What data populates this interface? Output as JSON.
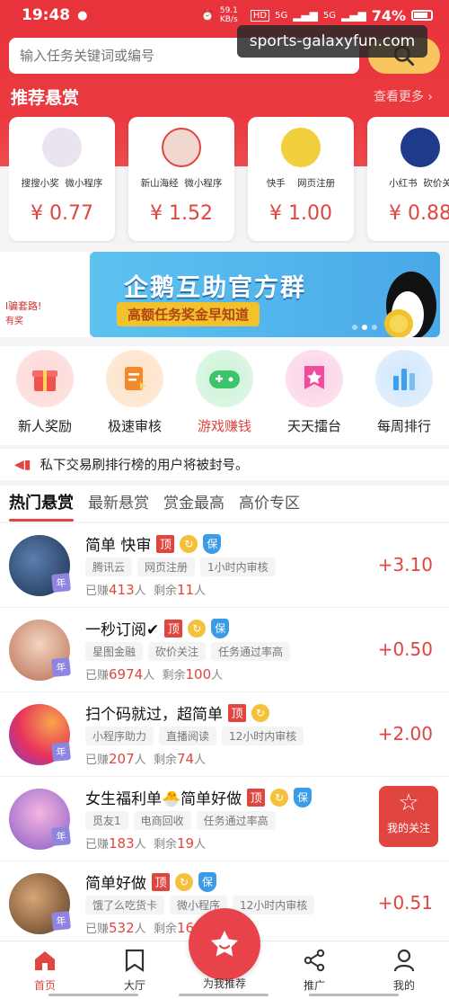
{
  "status_bar": {
    "time": "19:48",
    "speed": "59.1 KB/s",
    "hd": "HD",
    "net1": "5G",
    "net2": "5G",
    "battery": "74%"
  },
  "watermark": "sports-galaxyfun.com",
  "search": {
    "placeholder": "输入任务关键词或编号"
  },
  "recommended": {
    "title": "推荐悬赏",
    "more": "查看更多 ›",
    "cards": [
      {
        "tag1": "搜搜小奖",
        "tag2": "微小程序",
        "price": "¥ 0.77",
        "avatar_color": "#e9e4ef"
      },
      {
        "tag1": "新山海经",
        "tag2": "微小程序",
        "price": "¥ 1.52",
        "avatar_color": "#f2d6d0"
      },
      {
        "tag1": "快手",
        "tag2": "网页注册",
        "price": "¥ 1.00",
        "avatar_color": "#f2cf3c"
      },
      {
        "tag1": "小红书",
        "tag2": "砍价关",
        "price": "¥ 0.88",
        "avatar_color": "#1e3a8a"
      }
    ]
  },
  "banner": {
    "left_text1": "l骗套路!",
    "left_text2": "有奖",
    "title": "企鹅互助官方群",
    "subtitle": "高额任务奖金早知道"
  },
  "quick_nav": [
    {
      "label": "新人奖励",
      "icon": "gift-icon",
      "color": "#f0534f"
    },
    {
      "label": "极速审核",
      "icon": "document-icon",
      "color": "#f28a2c"
    },
    {
      "label": "游戏赚钱",
      "icon": "gamepad-icon",
      "color": "#3cc46a"
    },
    {
      "label": "天天擂台",
      "icon": "star-flag-icon",
      "color": "#f04c9b"
    },
    {
      "label": "每周排行",
      "icon": "bar-chart-icon",
      "color": "#3e9ef0"
    }
  ],
  "notice": "私下交易刷排行榜的用户将被封号。",
  "tabs": [
    "热门悬赏",
    "最新悬赏",
    "赏金最高",
    "高价专区"
  ],
  "tasks": [
    {
      "title": "简单 快审",
      "tags": [
        "腾讯云",
        "网页注册",
        "1小时内审核"
      ],
      "earned_label": "已赚",
      "earned": "413",
      "unit": "人",
      "remain_label": "剩余",
      "remain": "11",
      "reward": "+3.10",
      "badges": [
        "顶",
        "↻",
        "保"
      ],
      "avatar_color": "#2a4d7a"
    },
    {
      "title": "一秒订阅✔",
      "tags": [
        "星图金融",
        "砍价关注",
        "任务通过率高"
      ],
      "earned_label": "已赚",
      "earned": "6974",
      "unit": "人",
      "remain_label": "剩余",
      "remain": "100",
      "reward": "+0.50",
      "badges": [
        "顶",
        "↻",
        "保"
      ],
      "avatar_color": "#d99a7a"
    },
    {
      "title": "扫个码就过，超简单",
      "tags": [
        "小程序助力",
        "直播阅读",
        "12小时内审核"
      ],
      "earned_label": "已赚",
      "earned": "207",
      "unit": "人",
      "remain_label": "剩余",
      "remain": "74",
      "reward": "+2.00",
      "badges": [
        "顶",
        "↻"
      ],
      "avatar_color": "#f05a6a"
    },
    {
      "title": "女生福利单🐣简单好做",
      "tags": [
        "觅友1",
        "电商回收",
        "任务通过率高"
      ],
      "earned_label": "已赚",
      "earned": "183",
      "unit": "人",
      "remain_label": "剩余",
      "remain": "19",
      "reward": "",
      "badges": [
        "顶",
        "↻",
        "保"
      ],
      "avatar_color": "#9b6fc8"
    },
    {
      "title": "简单好做",
      "tags": [
        "饿了么吃货卡",
        "微小程序",
        "12小时内审核"
      ],
      "earned_label": "已赚",
      "earned": "532",
      "unit": "人",
      "remain_label": "剩余",
      "remain": "16",
      "reward": "+0.51",
      "badges": [
        "顶",
        "↻",
        "保"
      ],
      "avatar_color": "#8a5a3a"
    }
  ],
  "fav_button": "我的关注",
  "bottom_nav": [
    {
      "label": "首页",
      "icon": "home-icon"
    },
    {
      "label": "大厅",
      "icon": "flag-icon"
    },
    {
      "label": "为我推荐",
      "icon": "star-icon"
    },
    {
      "label": "推广",
      "icon": "share-icon"
    },
    {
      "label": "我的",
      "icon": "user-icon"
    }
  ],
  "accent_color": "#e0453f"
}
